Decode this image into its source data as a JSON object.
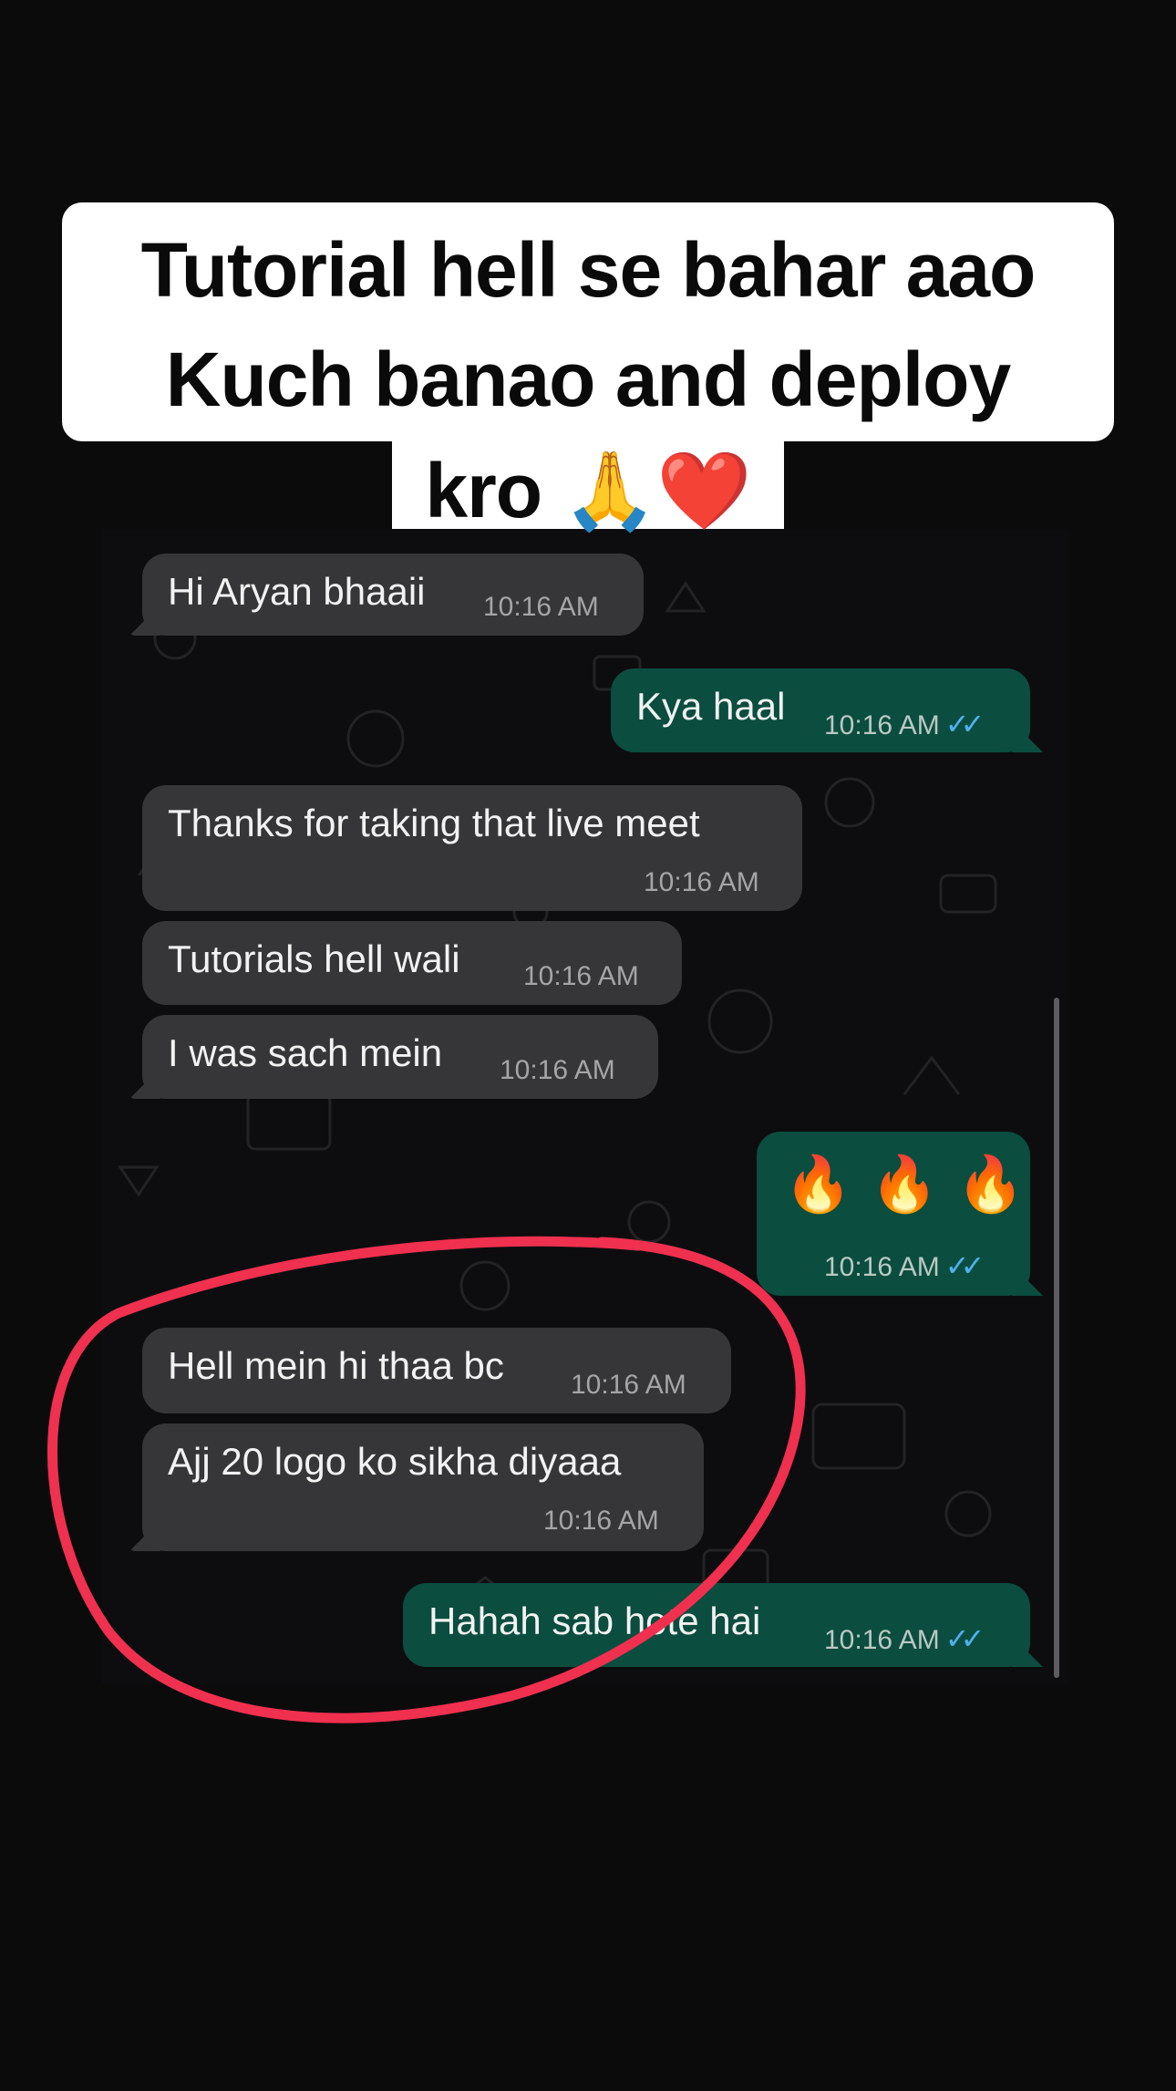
{
  "caption": {
    "line1": "Tutorial hell se bahar aao",
    "line2": "Kuch banao and deploy",
    "line3": "kro",
    "line3_emoji": "🙏❤️"
  },
  "messages": [
    {
      "direction": "in",
      "text": "Hi Aryan bhaaii",
      "time": "10:16 AM"
    },
    {
      "direction": "out",
      "text": "Kya haal",
      "time": "10:16 AM",
      "status": "read"
    },
    {
      "direction": "in",
      "text": "Thanks for taking that live meet",
      "time": "10:16 AM"
    },
    {
      "direction": "in",
      "text": "Tutorials hell wali",
      "time": "10:16 AM"
    },
    {
      "direction": "in",
      "text": "I was sach mein",
      "time": "10:16 AM"
    },
    {
      "direction": "out",
      "text": "🔥🔥🔥",
      "time": "10:16 AM",
      "status": "read"
    },
    {
      "direction": "in",
      "text": "Hell mein hi thaa bc",
      "time": "10:16 AM"
    },
    {
      "direction": "in",
      "text": "Ajj 20 logo ko sikha diyaaa",
      "time": "10:16 AM"
    },
    {
      "direction": "out",
      "text": "Hahah sab hote hai",
      "time": "10:16 AM",
      "status": "read"
    }
  ],
  "icons": {
    "read_receipt": "double-check-icon"
  },
  "colors": {
    "incoming_bubble": "#363638",
    "outgoing_bubble": "#0b4d3f",
    "read_tick": "#4fb1f0",
    "annotation_circle": "#f0304f"
  }
}
